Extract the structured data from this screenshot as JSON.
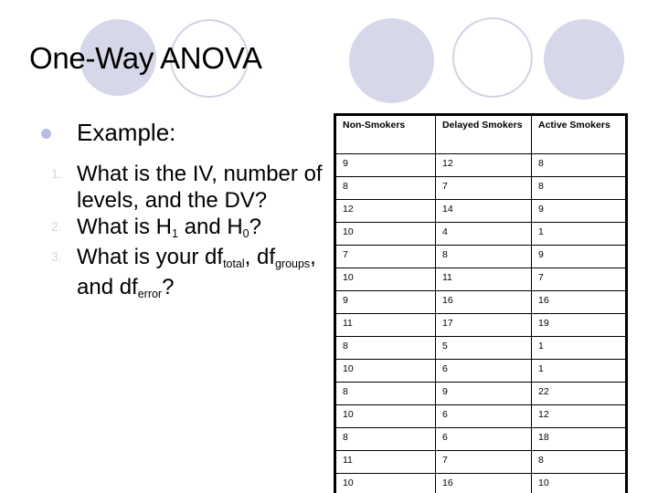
{
  "slide": {
    "title": "One-Way ANOVA"
  },
  "decor": {
    "fill_color": "#d7d7ea",
    "ring_color": "#d2d2e4",
    "bullet_color": "#b6bbe8",
    "number_color": "#d6d6d6"
  },
  "body": {
    "bullet_label": "Example:",
    "questions": [
      {
        "marker": "1.",
        "parts": [
          {
            "text": "What is the IV, number of levels, and the DV?"
          }
        ]
      },
      {
        "marker": "2.",
        "parts": [
          {
            "text": "What is H"
          },
          {
            "sub": "1"
          },
          {
            "text": " and H"
          },
          {
            "sub": "0"
          },
          {
            "text": "?"
          }
        ]
      },
      {
        "marker": "3.",
        "parts": [
          {
            "text": "What is your df"
          },
          {
            "sub": "total"
          },
          {
            "text": ", df"
          },
          {
            "sub": "groups"
          },
          {
            "text": ", and df"
          },
          {
            "sub": "error"
          },
          {
            "text": "?"
          }
        ]
      }
    ]
  },
  "table": {
    "headers": [
      "Non-Smokers",
      "Delayed Smokers",
      "Active Smokers"
    ],
    "rows": [
      [
        "9",
        "12",
        "8"
      ],
      [
        "8",
        "7",
        "8"
      ],
      [
        "12",
        "14",
        "9"
      ],
      [
        "10",
        "4",
        "1"
      ],
      [
        "7",
        "8",
        "9"
      ],
      [
        "10",
        "11",
        "7"
      ],
      [
        "9",
        "16",
        "16"
      ],
      [
        "11",
        "17",
        "19"
      ],
      [
        "8",
        "5",
        "1"
      ],
      [
        "10",
        "6",
        "1"
      ],
      [
        "8",
        "9",
        "22"
      ],
      [
        "10",
        "6",
        "12"
      ],
      [
        "8",
        "6",
        "18"
      ],
      [
        "11",
        "7",
        "8"
      ],
      [
        "10",
        "16",
        "10"
      ]
    ]
  }
}
